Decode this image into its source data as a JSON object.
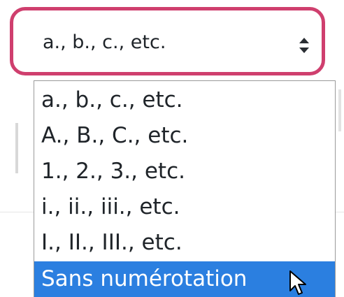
{
  "select": {
    "value": "a., b., c., etc.",
    "caret_icon": "updown-caret-icon",
    "focus_color": "#cf3f6e"
  },
  "dropdown": {
    "options": [
      {
        "label": "a., b., c., etc."
      },
      {
        "label": "A., B., C., etc."
      },
      {
        "label": "1., 2., 3., etc."
      },
      {
        "label": "i., ii., iii., etc."
      },
      {
        "label": "I., II., III., etc."
      },
      {
        "label": "Sans numérotation",
        "highlighted": true
      }
    ],
    "highlight_color": "#2b7fe0"
  },
  "cursor_icon": "arrow-cursor-icon"
}
